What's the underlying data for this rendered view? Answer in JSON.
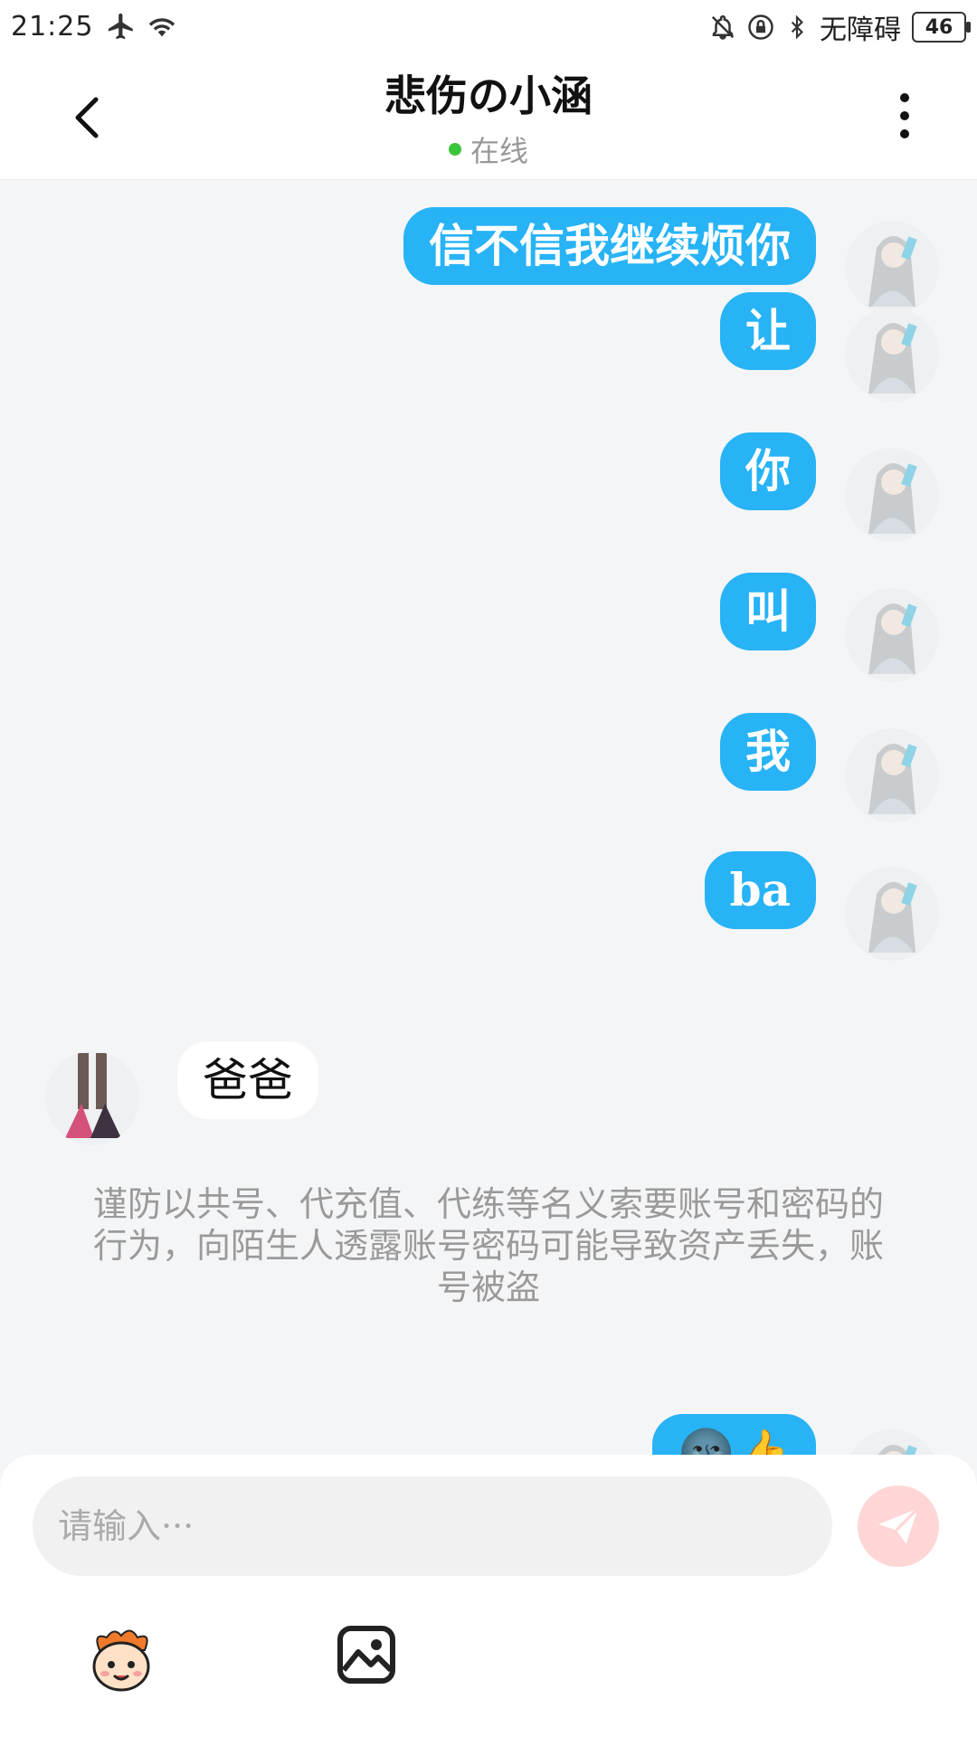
{
  "status_bar": {
    "time": "21:25",
    "accessibility_label": "无障碍",
    "battery": "46"
  },
  "header": {
    "title": "悲伤の小涵",
    "status": "在线"
  },
  "messages": [
    {
      "side": "out",
      "text": "信不信我继续烦你"
    },
    {
      "side": "out",
      "text": "让"
    },
    {
      "side": "out",
      "text": "你"
    },
    {
      "side": "out",
      "text": "叫"
    },
    {
      "side": "out",
      "text": "我"
    },
    {
      "side": "out",
      "text": "ba"
    },
    {
      "side": "in",
      "text": "爸爸"
    },
    {
      "side": "out",
      "text": "🌚👍"
    }
  ],
  "notice": "谨防以共号、代充值、代练等名义索要账号和密码的行为，向陌生人透露账号密码可能导致资产丢失，账号被盗",
  "input": {
    "placeholder": "请输入···"
  },
  "colors": {
    "accent": "#27b3f5",
    "online": "#3cc43c",
    "send_disabled": "#ffd6d6"
  },
  "icons": [
    "back-icon",
    "more-icon",
    "send-icon",
    "emoji-icon",
    "image-icon"
  ]
}
